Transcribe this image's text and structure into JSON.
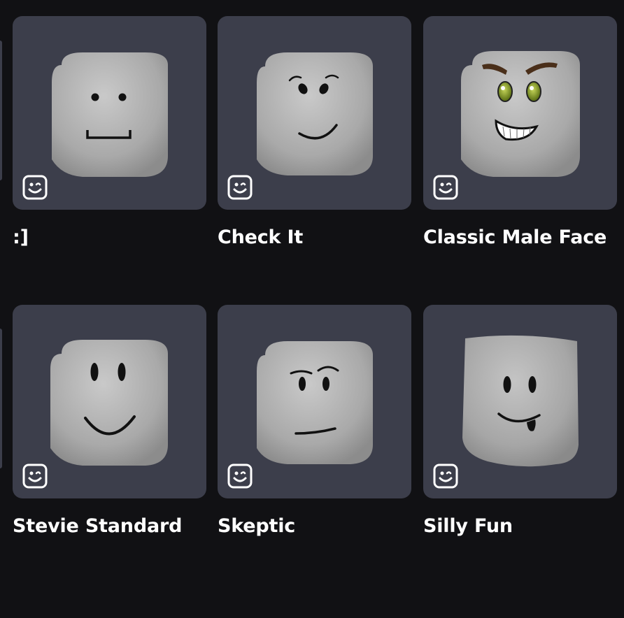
{
  "items": [
    {
      "name": ":]",
      "face": "simple"
    },
    {
      "name": "Check It",
      "face": "check-it"
    },
    {
      "name": "Classic Male Face",
      "face": "classic-male"
    },
    {
      "name": "Stevie Standard",
      "face": "stevie"
    },
    {
      "name": "Skeptic",
      "face": "skeptic"
    },
    {
      "name": "Silly Fun",
      "face": "silly-fun"
    }
  ],
  "badge_icon": "face-badge-icon",
  "colors": {
    "background": "#111114",
    "card": "#3c3e4b",
    "text": "#ffffff"
  }
}
